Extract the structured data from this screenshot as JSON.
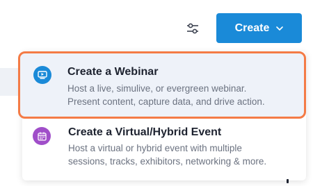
{
  "toolbar": {
    "filter_icon": "sliders-icon",
    "create_label": "Create",
    "create_chevron_icon": "chevron-down-icon"
  },
  "dropdown": {
    "items": [
      {
        "title": "Create a Webinar",
        "desc_line1": "Host a live, simulive, or evergreen webinar.",
        "desc_line2": "Present content, capture data, and drive action.",
        "icon": "video-screen-icon",
        "icon_color": "#1a8ad8",
        "highlighted": true
      },
      {
        "title": "Create a Virtual/Hybrid Event",
        "desc_line1": "Host a virtual or hybrid event with multiple",
        "desc_line2": "sessions, tracks, exhibitors, networking & more.",
        "icon": "calendar-icon",
        "icon_color": "#a04ec9",
        "highlighted": false
      }
    ]
  },
  "colors": {
    "accent": "#1a8ad8",
    "highlight_border": "#f47b46",
    "highlight_bg": "#eef2f9"
  }
}
